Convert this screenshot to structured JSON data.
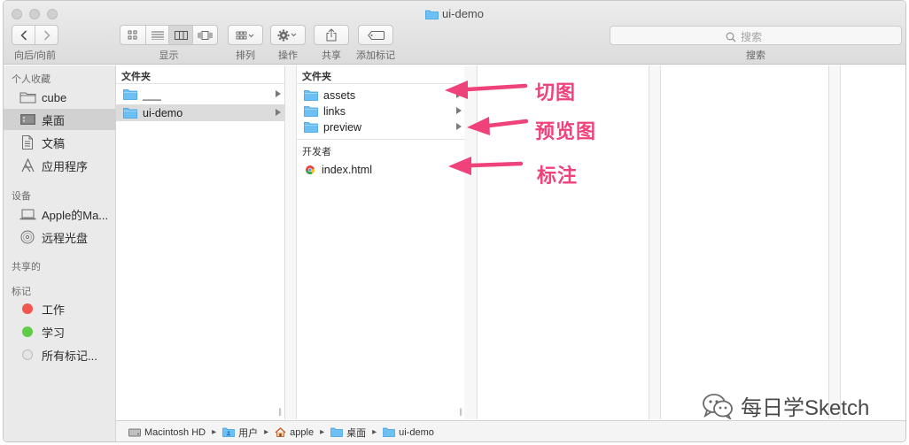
{
  "window": {
    "title": "ui-demo"
  },
  "toolbar": {
    "nav_label": "向后/向前",
    "view_label": "显示",
    "arrange_label": "排列",
    "action_label": "操作",
    "share_label": "共享",
    "tags_label": "添加标记",
    "search_label": "搜索",
    "search_placeholder": "搜索"
  },
  "sidebar": {
    "favorites_header": "个人收藏",
    "favorites": [
      {
        "label": "cube",
        "icon": "folder-icon"
      },
      {
        "label": "桌面",
        "icon": "desktop-icon",
        "selected": true
      },
      {
        "label": "文稿",
        "icon": "document-icon"
      },
      {
        "label": "应用程序",
        "icon": "applications-icon"
      }
    ],
    "devices_header": "设备",
    "devices": [
      {
        "label": "Apple的Ma...",
        "icon": "laptop-icon"
      },
      {
        "label": "远程光盘",
        "icon": "disc-icon"
      }
    ],
    "shared_header": "共享的",
    "tags_header": "标记",
    "tags": [
      {
        "label": "工作",
        "color": "#f2574f"
      },
      {
        "label": "学习",
        "color": "#5fcc47"
      },
      {
        "label": "所有标记...",
        "color": "#d9d9d9"
      }
    ]
  },
  "columns": [
    {
      "header": "文件夹",
      "items": [
        {
          "label": "___",
          "type": "folder"
        },
        {
          "label": "ui-demo",
          "type": "folder",
          "selected": true
        }
      ]
    },
    {
      "header": "文件夹",
      "items": [
        {
          "label": "assets",
          "type": "folder"
        },
        {
          "label": "links",
          "type": "folder"
        },
        {
          "label": "preview",
          "type": "folder"
        }
      ],
      "section2_header": "开发者",
      "items2": [
        {
          "label": "index.html",
          "type": "html"
        }
      ]
    }
  ],
  "pathbar": [
    {
      "label": "Macintosh HD",
      "icon": "hard-drive-icon"
    },
    {
      "label": "用户",
      "icon": "folder-icon"
    },
    {
      "label": "apple",
      "icon": "home-icon"
    },
    {
      "label": "桌面",
      "icon": "folder-icon"
    },
    {
      "label": "ui-demo",
      "icon": "folder-icon"
    }
  ],
  "annotations": {
    "slices": "切图",
    "preview": "预览图",
    "markup": "标注",
    "color": "#f0427a"
  },
  "watermark": {
    "text": "每日学Sketch"
  }
}
